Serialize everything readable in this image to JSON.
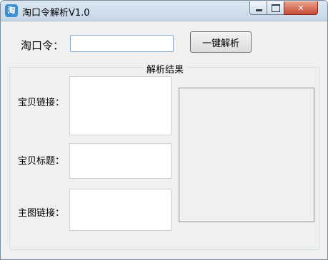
{
  "window": {
    "title": "淘口令解析V1.0",
    "app_icon": "taobao-icon"
  },
  "controls": {
    "minimize_icon": "minimize-icon",
    "maximize_icon": "maximize-icon",
    "close_icon": "close-icon"
  },
  "form": {
    "command_label": "淘口令：",
    "command_value": "",
    "parse_button": "一键解析"
  },
  "results": {
    "group_title": "解析结果",
    "item_link_label": "宝贝链接：",
    "item_title_label": "宝贝标题：",
    "main_image_label": "主图链接：",
    "item_link_value": "",
    "item_title_value": "",
    "main_image_value": ""
  },
  "colors": {
    "titlebar": "#c7d7e8",
    "close_button": "#c74a32",
    "window_bg": "#f0f0f0"
  }
}
